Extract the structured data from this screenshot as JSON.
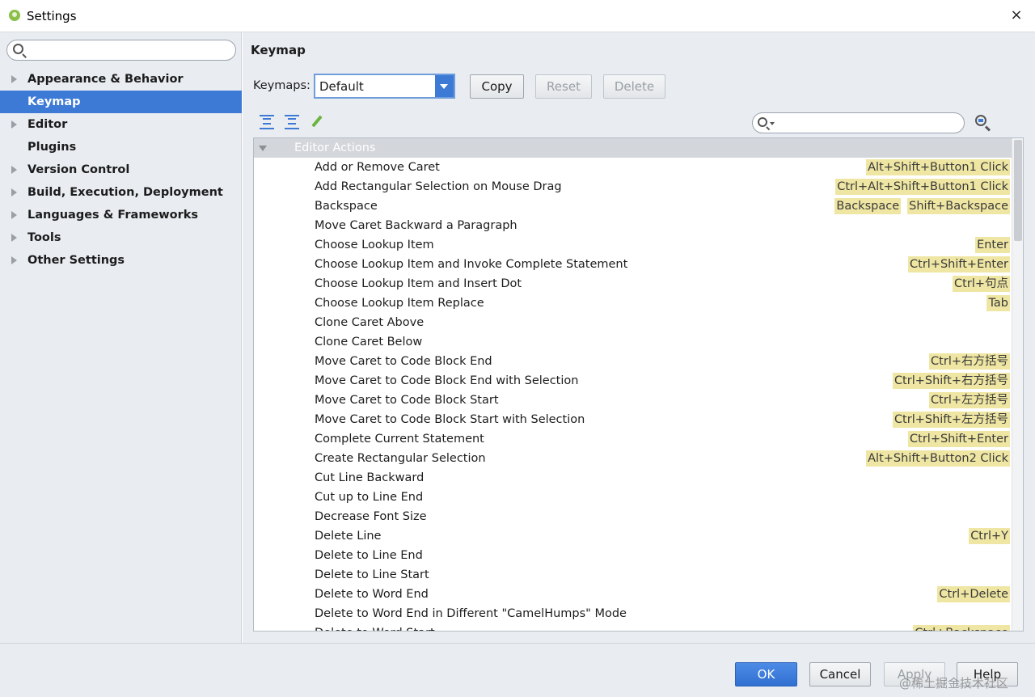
{
  "window": {
    "title": "Settings",
    "close_glyph": "×"
  },
  "sidebar": {
    "search": {
      "placeholder": "",
      "value": ""
    },
    "items": [
      {
        "label": "Appearance & Behavior",
        "expandable": true
      },
      {
        "label": "Keymap",
        "expandable": false,
        "selected": true
      },
      {
        "label": "Editor",
        "expandable": true
      },
      {
        "label": "Plugins",
        "expandable": false
      },
      {
        "label": "Version Control",
        "expandable": true
      },
      {
        "label": "Build, Execution, Deployment",
        "expandable": true
      },
      {
        "label": "Languages & Frameworks",
        "expandable": true
      },
      {
        "label": "Tools",
        "expandable": true
      },
      {
        "label": "Other Settings",
        "expandable": true
      }
    ]
  },
  "main": {
    "heading": "Keymap",
    "keymaps_label": "Keymaps:",
    "keymap_selected": "Default",
    "buttons": {
      "copy": "Copy",
      "reset": "Reset",
      "delete": "Delete"
    },
    "shortcut_search": {
      "value": ""
    },
    "group": "Editor Actions",
    "actions": [
      {
        "name": "Add or Remove Caret",
        "shortcuts": [
          "Alt+Shift+Button1 Click"
        ]
      },
      {
        "name": "Add Rectangular Selection on Mouse Drag",
        "shortcuts": [
          "Ctrl+Alt+Shift+Button1 Click"
        ]
      },
      {
        "name": "Backspace",
        "shortcuts": [
          "Backspace",
          "Shift+Backspace"
        ]
      },
      {
        "name": "Move Caret Backward a Paragraph",
        "shortcuts": []
      },
      {
        "name": "Choose Lookup Item",
        "shortcuts": [
          "Enter"
        ]
      },
      {
        "name": "Choose Lookup Item and Invoke Complete Statement",
        "shortcuts": [
          "Ctrl+Shift+Enter"
        ]
      },
      {
        "name": "Choose Lookup Item and Insert Dot",
        "shortcuts": [
          "Ctrl+句点"
        ]
      },
      {
        "name": "Choose Lookup Item Replace",
        "shortcuts": [
          "Tab"
        ]
      },
      {
        "name": "Clone Caret Above",
        "shortcuts": []
      },
      {
        "name": "Clone Caret Below",
        "shortcuts": []
      },
      {
        "name": "Move Caret to Code Block End",
        "shortcuts": [
          "Ctrl+右方括号"
        ]
      },
      {
        "name": "Move Caret to Code Block End with Selection",
        "shortcuts": [
          "Ctrl+Shift+右方括号"
        ]
      },
      {
        "name": "Move Caret to Code Block Start",
        "shortcuts": [
          "Ctrl+左方括号"
        ]
      },
      {
        "name": "Move Caret to Code Block Start with Selection",
        "shortcuts": [
          "Ctrl+Shift+左方括号"
        ]
      },
      {
        "name": "Complete Current Statement",
        "shortcuts": [
          "Ctrl+Shift+Enter"
        ]
      },
      {
        "name": "Create Rectangular Selection",
        "shortcuts": [
          "Alt+Shift+Button2 Click"
        ]
      },
      {
        "name": "Cut Line Backward",
        "shortcuts": []
      },
      {
        "name": "Cut up to Line End",
        "shortcuts": []
      },
      {
        "name": "Decrease Font Size",
        "shortcuts": []
      },
      {
        "name": "Delete Line",
        "shortcuts": [
          "Ctrl+Y"
        ]
      },
      {
        "name": "Delete to Line End",
        "shortcuts": []
      },
      {
        "name": "Delete to Line Start",
        "shortcuts": []
      },
      {
        "name": "Delete to Word End",
        "shortcuts": [
          "Ctrl+Delete"
        ]
      },
      {
        "name": "Delete to Word End in Different \"CamelHumps\" Mode",
        "shortcuts": []
      },
      {
        "name": "Delete to Word Start",
        "shortcuts": [
          "Ctrl+Backspace"
        ]
      }
    ]
  },
  "footer": {
    "ok": "OK",
    "cancel": "Cancel",
    "apply": "Apply",
    "help": "Help"
  },
  "watermark": "@稀土掘金技术社区",
  "colors": {
    "accent": "#3d7ad6",
    "shortcut_bg": "#efe6a3",
    "panel_bg": "#e9edf2"
  },
  "icons": [
    "app-icon",
    "close-icon",
    "search-icon",
    "expand-all-icon",
    "collapse-all-icon",
    "edit-shortcut-icon",
    "find-by-shortcut-icon"
  ]
}
